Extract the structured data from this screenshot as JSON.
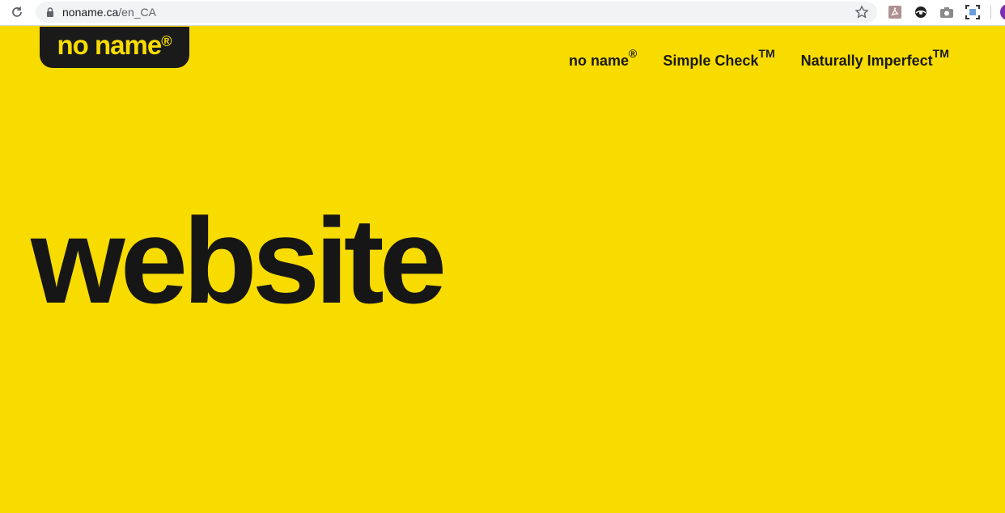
{
  "browser": {
    "url_host": "noname.ca",
    "url_path": "/en_CA"
  },
  "header": {
    "logo_text": "no name",
    "logo_mark": "®",
    "nav": [
      {
        "label": "no name",
        "mark": "®"
      },
      {
        "label": "Simple Check",
        "mark": "TM"
      },
      {
        "label": "Naturally Imperfect",
        "mark": "TM"
      }
    ]
  },
  "hero": {
    "text": "website"
  },
  "colors": {
    "brand_yellow": "#f8dc00",
    "brand_black": "#1a1a1a"
  },
  "icons": [
    "reload-icon",
    "lock-icon",
    "star-icon",
    "pdf-extension-icon",
    "eye-extension-icon",
    "camera-extension-icon",
    "screenshot-extension-icon",
    "profile-avatar"
  ]
}
